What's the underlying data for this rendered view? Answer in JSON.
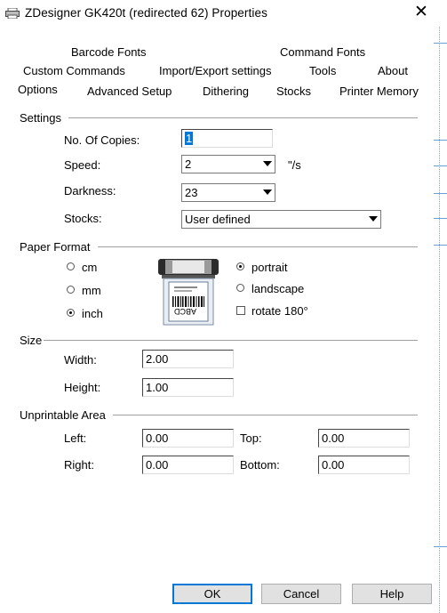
{
  "window": {
    "title": "ZDesigner GK420t (redirected 62) Properties",
    "close_glyph": "✕"
  },
  "tabs": {
    "row1": [
      "Barcode Fonts",
      "Command Fonts"
    ],
    "row2": [
      "Custom Commands",
      "Import/Export settings",
      "Tools",
      "About"
    ],
    "row3": [
      "Options",
      "Advanced Setup",
      "Dithering",
      "Stocks",
      "Printer Memory"
    ],
    "selected": "Options"
  },
  "settings": {
    "group_label": "Settings",
    "copies_label": "No. Of Copies:",
    "copies_value": "1",
    "speed_label": "Speed:",
    "speed_value": "2",
    "speed_unit": "\"/s",
    "darkness_label": "Darkness:",
    "darkness_value": "23",
    "stocks_label": "Stocks:",
    "stocks_value": "User defined"
  },
  "paper_format": {
    "group_label": "Paper Format",
    "units": [
      "cm",
      "mm",
      "inch"
    ],
    "selected_unit": "inch",
    "orientation": [
      "portrait",
      "landscape"
    ],
    "selected_orientation": "portrait",
    "rotate_label": "rotate 180°",
    "rotate_checked": false,
    "label_image_text": "ABCD"
  },
  "size": {
    "group_label": "Size",
    "width_label": "Width:",
    "width_value": "2.00",
    "height_label": "Height:",
    "height_value": "1.00"
  },
  "unprintable": {
    "group_label": "Unprintable Area",
    "left_label": "Left:",
    "left_value": "0.00",
    "top_label": "Top:",
    "top_value": "0.00",
    "right_label": "Right:",
    "right_value": "0.00",
    "bottom_label": "Bottom:",
    "bottom_value": "0.00"
  },
  "buttons": {
    "ok": "OK",
    "cancel": "Cancel",
    "help": "Help"
  },
  "colors": {
    "accent": "#0078d7",
    "separator": "#a0a0a0",
    "button_face": "#e1e1e1"
  }
}
